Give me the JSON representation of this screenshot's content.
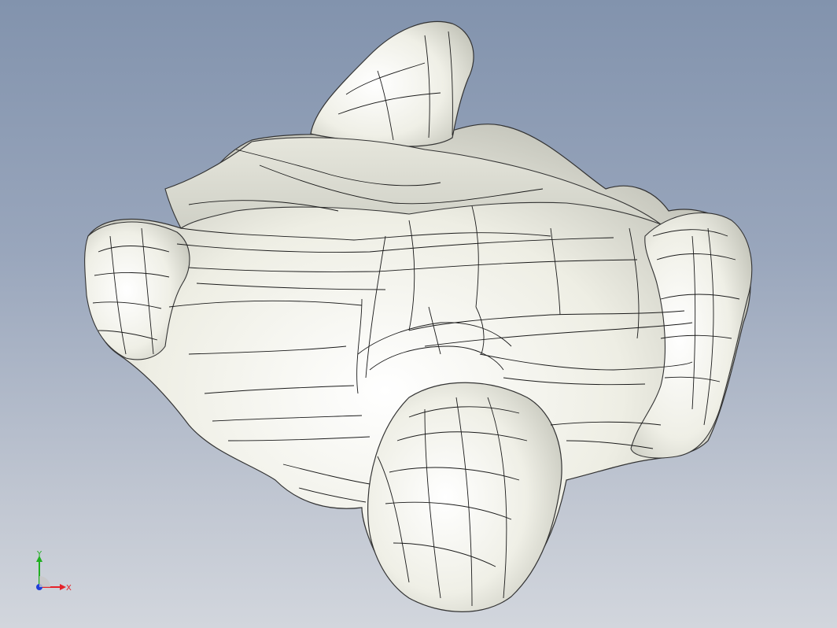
{
  "viewport": {
    "background_top": "#8293ad",
    "background_bottom": "#d2d6dd",
    "model": {
      "surface_color": "#f3f3ea",
      "edge_color": "#111111"
    }
  },
  "triad": {
    "x_label": "X",
    "y_label": "Y",
    "x_color": "#e5222a",
    "y_color": "#20b020",
    "z_color": "#1f3fd8"
  }
}
